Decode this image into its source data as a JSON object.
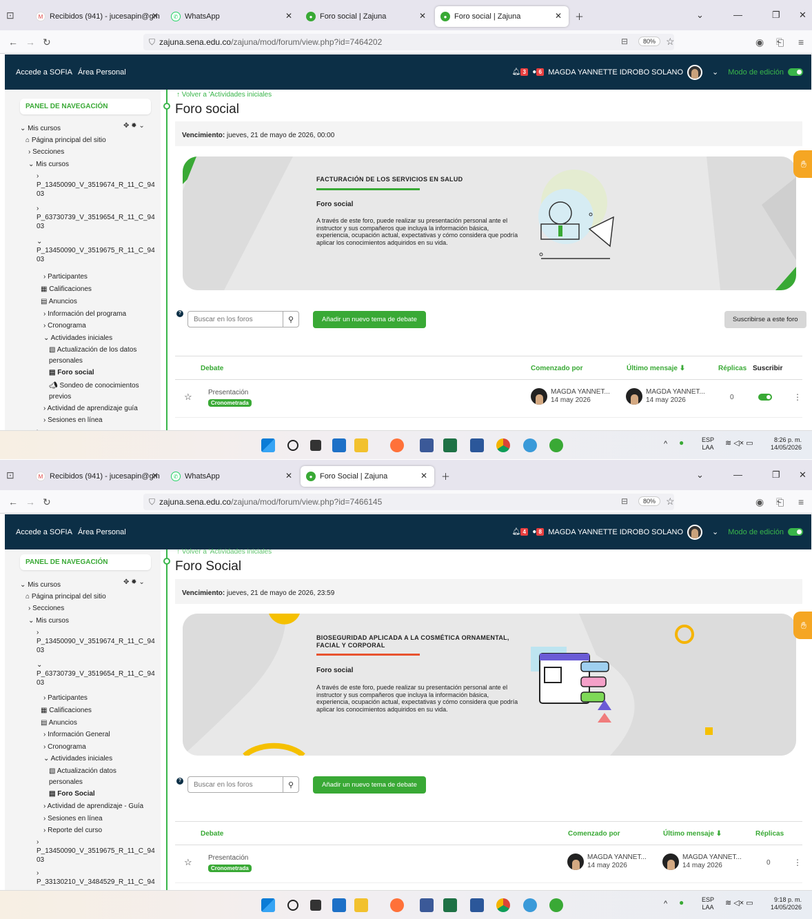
{
  "screens": [
    {
      "tabs": [
        {
          "label": "Recibidos (941) - jucesapin@gm",
          "icon": "gmail-icon"
        },
        {
          "label": "WhatsApp",
          "icon": "whatsapp-icon"
        },
        {
          "label": "Foro social | Zajuna",
          "icon": "zajuna-icon"
        },
        {
          "label": "Foro social | Zajuna",
          "icon": "zajuna-icon"
        }
      ],
      "url_host": "zajuna.sena.edu.co",
      "url_path": "/zajuna/mod/forum/view.php?id=7464202",
      "zoom": "80%",
      "topnav": {
        "link1": "Accede a SOFIA",
        "link2": "Área Personal",
        "notif_count": "3",
        "msg_count": "6",
        "user": "MAGDA YANNETTE IDROBO SOLANO",
        "edit_mode": "Modo de edición"
      },
      "panel_title": "PANEL DE NAVEGACIÓN",
      "nav": [
        "Mis cursos",
        "Página principal del sitio",
        "Secciones",
        "Mis cursos",
        "P_13450090_V_3519674_R_11_C_94",
        "03",
        "P_63730739_V_3519654_R_11_C_94",
        "03",
        "P_13450090_V_3519675_R_11_C_94",
        "03",
        "Participantes",
        "Calificaciones",
        "Anuncios",
        "Información del programa",
        "Cronograma",
        "Actividades iniciales",
        "Actualización de los datos",
        "personales",
        "Foro social",
        "Sondeo de conocimientos",
        "previos",
        "Actividad de aprendizaje guía",
        "Sesiones en línea"
      ],
      "back": "Volver a 'Actividades iniciales",
      "title": "Foro social",
      "due_label": "Vencimiento:",
      "due_value": " jueves, 21 de mayo de 2026, 00:00",
      "banner": {
        "title": "FACTURACIÓN DE LOS SERVICIOS EN SALUD",
        "subtitle": "Foro social",
        "text": "A través de este foro, puede realizar su presentación personal ante el instructor y sus compañeros que incluya la información básica, experiencia, ocupación actual, expectativas y cómo considera que podría aplicar los conocimientos adquiridos en su vida.",
        "bar_color": "#39a935"
      },
      "search_placeholder": "Buscar en los foros",
      "add_button": "Añadir un nuevo tema de debate",
      "subscribe_button": "Suscribirse a este foro",
      "columns": {
        "debate": "Debate",
        "started": "Comenzado por",
        "last": "Último mensaje ⬇",
        "replies": "Réplicas",
        "subscribe": "Suscribir"
      },
      "row": {
        "topic": "Presentación",
        "tag": "Cronometrada",
        "started_by": "MAGDA YANNET...",
        "started_date": "14 may 2026",
        "last_by": "MAGDA YANNET...",
        "last_date": "14 may 2026",
        "replies": "0"
      },
      "tray": {
        "lang1": "ESP",
        "lang2": "LAA",
        "time": "8:26 p. m.",
        "date": "14/05/2026"
      }
    },
    {
      "tabs": [
        {
          "label": "Recibidos (941) - jucesapin@gm",
          "icon": "gmail-icon"
        },
        {
          "label": "WhatsApp",
          "icon": "whatsapp-icon"
        },
        {
          "label": "Foro Social | Zajuna",
          "icon": "zajuna-icon"
        }
      ],
      "url_host": "zajuna.sena.edu.co",
      "url_path": "/zajuna/mod/forum/view.php?id=7466145",
      "zoom": "80%",
      "topnav": {
        "link1": "Accede a SOFIA",
        "link2": "Área Personal",
        "notif_count": "4",
        "msg_count": "8",
        "user": "MAGDA YANNETTE IDROBO SOLANO",
        "edit_mode": "Modo de edición"
      },
      "panel_title": "PANEL DE NAVEGACIÓN",
      "nav": [
        "Mis cursos",
        "Página principal del sitio",
        "Secciones",
        "Mis cursos",
        "P_13450090_V_3519674_R_11_C_94",
        "03",
        "P_63730739_V_3519654_R_11_C_94",
        "03",
        "Participantes",
        "Calificaciones",
        "Anuncios",
        "Información General",
        "Cronograma",
        "Actividades iniciales",
        "Actualización datos",
        "personales",
        "Foro Social",
        "Actividad de aprendizaje - Guía",
        "Sesiones en línea",
        "Reporte del curso",
        "P_13450090_V_3519675_R_11_C_94",
        "03",
        "P_33130210_V_3484529_R_11_C_94"
      ],
      "back": "Volver a 'Actividades iniciales",
      "title": "Foro Social",
      "due_label": "Vencimiento:",
      "due_value": " jueves, 21 de mayo de 2026, 23:59",
      "banner": {
        "title": "BIOSEGURIDAD APLICADA A LA COSMÉTICA ORNAMENTAL, FACIAL Y CORPORAL",
        "subtitle": "Foro social",
        "text": "A través de este foro, puede realizar su presentación personal ante el instructor y sus compañeros que incluya la información básica, experiencia, ocupación actual, expectativas y cómo considera que podría aplicar los conocimientos adquiridos en su vida.",
        "bar_color": "#e8532f"
      },
      "search_placeholder": "Buscar en los foros",
      "add_button": "Añadir un nuevo tema de debate",
      "columns": {
        "debate": "Debate",
        "started": "Comenzado por",
        "last": "Último mensaje ⬇",
        "replies": "Réplicas"
      },
      "row": {
        "topic": "Presentación",
        "tag": "Cronometrada",
        "started_by": "MAGDA YANNET...",
        "started_date": "14 may 2026",
        "last_by": "MAGDA YANNET...",
        "last_date": "14 may 2026",
        "replies": "0"
      },
      "tray": {
        "lang1": "ESP",
        "lang2": "LAA",
        "time": "9:18 p. m.",
        "date": "14/05/2026"
      }
    }
  ]
}
